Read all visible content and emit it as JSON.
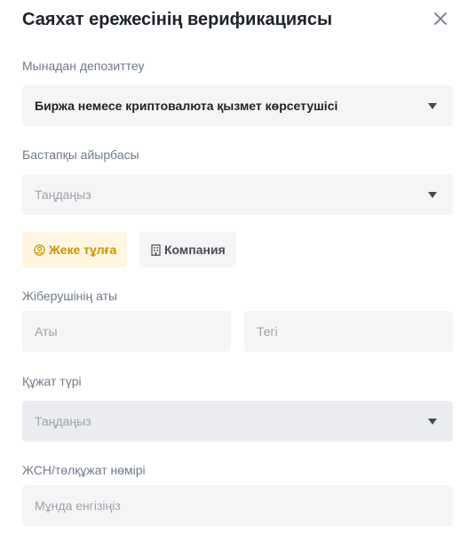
{
  "modal": {
    "title": "Саяхат ережесінің верификациясы"
  },
  "deposit_from": {
    "label": "Мынадан депозиттеу",
    "value": "Биржа немесе криптовалюта қызмет көрсетушісі"
  },
  "source_exchange": {
    "label": "Бастапқы айырбасы",
    "placeholder": "Таңдаңыз"
  },
  "entity_type": {
    "individual": "Жеке тұлға",
    "company": "Компания",
    "selected": "individual"
  },
  "sender_name": {
    "label": "Жіберушінің аты",
    "first_placeholder": "Аты",
    "last_placeholder": "Тегі"
  },
  "document_type": {
    "label": "Құжат түрі",
    "placeholder": "Таңдаңыз"
  },
  "id_number": {
    "label": "ЖСН/төлқұжат нөмірі",
    "placeholder": "Мұнда енгізіңіз"
  },
  "colors": {
    "accent": "#c99400",
    "accent_bg": "#fef6e0",
    "field_bg": "#f5f5f5",
    "text_primary": "#1e2329",
    "text_secondary": "#707a8a"
  }
}
